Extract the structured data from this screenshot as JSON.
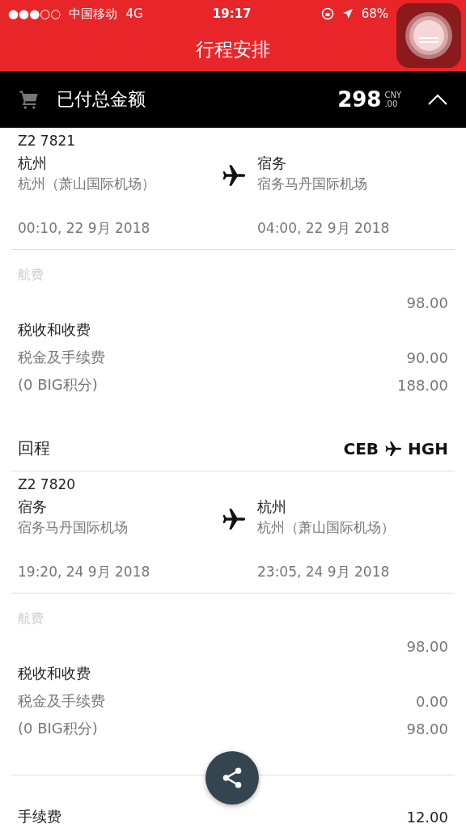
{
  "status_bar": {
    "signal_dots": "●●●○○",
    "carrier": "中国移动",
    "network": "4G",
    "time": "19:17",
    "battery": "68%"
  },
  "title": "行程安排",
  "summary": {
    "label": "已付总金额",
    "amount": "298",
    "currency": "CNY",
    "cents": ".00",
    "expanded": true
  },
  "legs": [
    {
      "flight": "Z2 7821",
      "from": {
        "city": "杭州",
        "airport": "杭州（萧山国际机场）",
        "time": "00:10, 22 9月 2018"
      },
      "to": {
        "city": "宿务",
        "airport": "宿务马丹国际机场",
        "time": "04:00, 22 9月 2018"
      },
      "fare_label": "航费",
      "fare": "98.00",
      "tax_title": "税收和收费",
      "tax_label": "税金及手续费",
      "tax": "90.00",
      "points_label": "(0 BIG积分)",
      "total": "188.00"
    },
    {
      "heading": {
        "title": "回程",
        "origin": "CEB",
        "destination": "HGH"
      },
      "flight": "Z2 7820",
      "from": {
        "city": "宿务",
        "airport": "宿务马丹国际机场",
        "time": "19:20, 24 9月 2018"
      },
      "to": {
        "city": "杭州",
        "airport": "杭州（萧山国际机场）",
        "time": "23:05, 24 9月 2018"
      },
      "fare_label": "航费",
      "fare": "98.00",
      "tax_title": "税收和收费",
      "tax_label": "税金及手续费",
      "tax": "0.00",
      "points_label": "(0 BIG积分)",
      "total": "98.00"
    }
  ],
  "service_fee": {
    "label": "手续费",
    "amount": "12.00"
  }
}
